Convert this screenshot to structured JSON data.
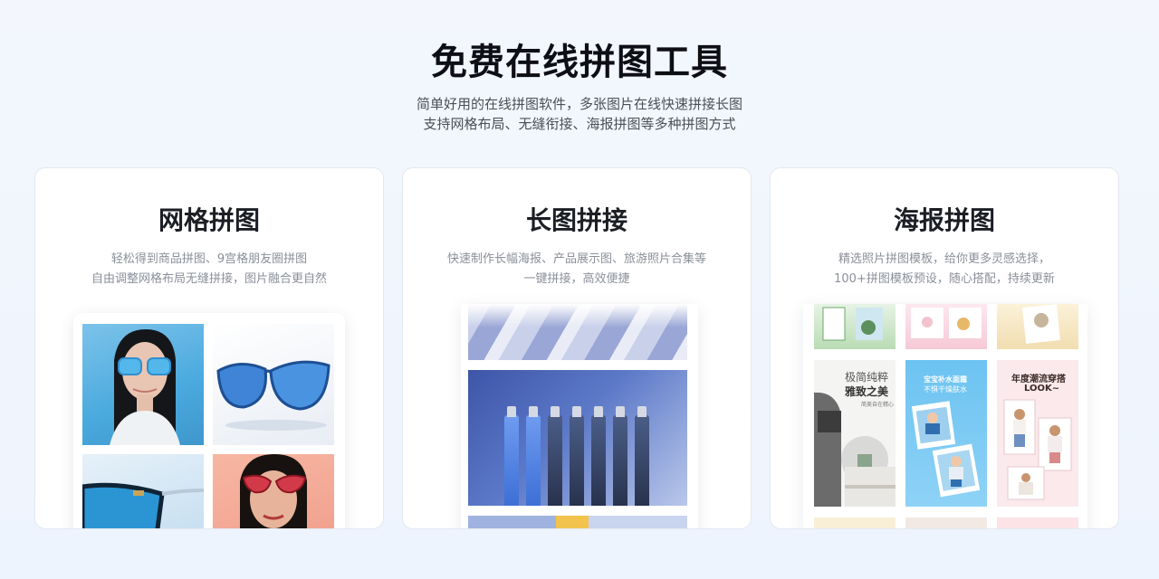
{
  "hero": {
    "title": "免费在线拼图工具",
    "subtitle_line1": "简单好用的在线拼图软件，多张图片在线快速拼接长图",
    "subtitle_line2": "支持网格布局、无缝衔接、海报拼图等多种拼图方式"
  },
  "cards": [
    {
      "title": "网格拼图",
      "desc_line1": "轻松得到商品拼图、9宫格朋友圈拼图",
      "desc_line2": "自由调整网格布局无缝拼接，图片融合更自然"
    },
    {
      "title": "长图拼接",
      "desc_line1": "快速制作长幅海报、产品展示图、旅游照片合集等",
      "desc_line2": "一键拼接，高效便捷"
    },
    {
      "title": "海报拼图",
      "desc_line1": "精选照片拼图模板，给你更多灵感选择，",
      "desc_line2": "100+拼图模板预设，随心搭配，持续更新"
    }
  ],
  "poster_texts": {
    "p1_line1": "极简纯粹",
    "p1_line2": "雅致之美",
    "p1_small": "简美自在精心",
    "p2_line1": "宝宝补水面霜",
    "p2_line2": "不惧干燥肤水",
    "p3_line1": "年度潮流穿搭",
    "p3_line2": "LOOK~"
  },
  "colors": {
    "accent_blue": "#4aa9de",
    "title": "#0d0f14",
    "muted": "#8a8f99"
  }
}
